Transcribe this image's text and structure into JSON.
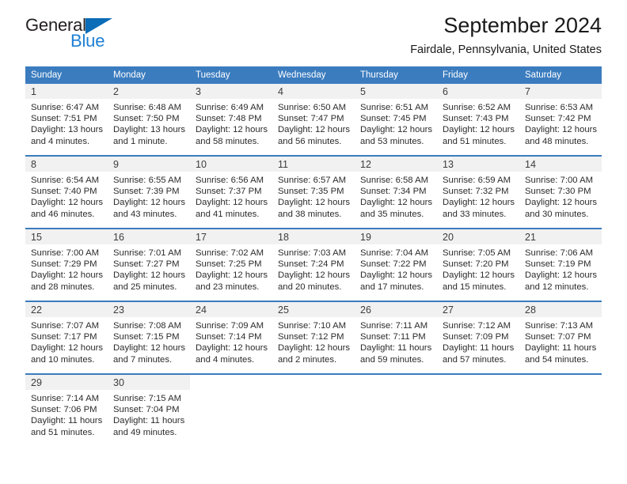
{
  "brand": {
    "name_part1": "General",
    "name_part2": "Blue",
    "triangle_color": "#0b6cb7",
    "blue_color": "#1e7fd4"
  },
  "header": {
    "title": "September 2024",
    "subtitle": "Fairdale, Pennsylvania, United States"
  },
  "theme": {
    "header_blue": "#3b7cbf",
    "daynum_band": "#f1f1f1"
  },
  "weekday_headers": [
    "Sunday",
    "Monday",
    "Tuesday",
    "Wednesday",
    "Thursday",
    "Friday",
    "Saturday"
  ],
  "weeks": [
    [
      {
        "day": "1",
        "sunrise": "Sunrise: 6:47 AM",
        "sunset": "Sunset: 7:51 PM",
        "daylight_line1": "Daylight: 13 hours",
        "daylight_line2": "and 4 minutes."
      },
      {
        "day": "2",
        "sunrise": "Sunrise: 6:48 AM",
        "sunset": "Sunset: 7:50 PM",
        "daylight_line1": "Daylight: 13 hours",
        "daylight_line2": "and 1 minute."
      },
      {
        "day": "3",
        "sunrise": "Sunrise: 6:49 AM",
        "sunset": "Sunset: 7:48 PM",
        "daylight_line1": "Daylight: 12 hours",
        "daylight_line2": "and 58 minutes."
      },
      {
        "day": "4",
        "sunrise": "Sunrise: 6:50 AM",
        "sunset": "Sunset: 7:47 PM",
        "daylight_line1": "Daylight: 12 hours",
        "daylight_line2": "and 56 minutes."
      },
      {
        "day": "5",
        "sunrise": "Sunrise: 6:51 AM",
        "sunset": "Sunset: 7:45 PM",
        "daylight_line1": "Daylight: 12 hours",
        "daylight_line2": "and 53 minutes."
      },
      {
        "day": "6",
        "sunrise": "Sunrise: 6:52 AM",
        "sunset": "Sunset: 7:43 PM",
        "daylight_line1": "Daylight: 12 hours",
        "daylight_line2": "and 51 minutes."
      },
      {
        "day": "7",
        "sunrise": "Sunrise: 6:53 AM",
        "sunset": "Sunset: 7:42 PM",
        "daylight_line1": "Daylight: 12 hours",
        "daylight_line2": "and 48 minutes."
      }
    ],
    [
      {
        "day": "8",
        "sunrise": "Sunrise: 6:54 AM",
        "sunset": "Sunset: 7:40 PM",
        "daylight_line1": "Daylight: 12 hours",
        "daylight_line2": "and 46 minutes."
      },
      {
        "day": "9",
        "sunrise": "Sunrise: 6:55 AM",
        "sunset": "Sunset: 7:39 PM",
        "daylight_line1": "Daylight: 12 hours",
        "daylight_line2": "and 43 minutes."
      },
      {
        "day": "10",
        "sunrise": "Sunrise: 6:56 AM",
        "sunset": "Sunset: 7:37 PM",
        "daylight_line1": "Daylight: 12 hours",
        "daylight_line2": "and 41 minutes."
      },
      {
        "day": "11",
        "sunrise": "Sunrise: 6:57 AM",
        "sunset": "Sunset: 7:35 PM",
        "daylight_line1": "Daylight: 12 hours",
        "daylight_line2": "and 38 minutes."
      },
      {
        "day": "12",
        "sunrise": "Sunrise: 6:58 AM",
        "sunset": "Sunset: 7:34 PM",
        "daylight_line1": "Daylight: 12 hours",
        "daylight_line2": "and 35 minutes."
      },
      {
        "day": "13",
        "sunrise": "Sunrise: 6:59 AM",
        "sunset": "Sunset: 7:32 PM",
        "daylight_line1": "Daylight: 12 hours",
        "daylight_line2": "and 33 minutes."
      },
      {
        "day": "14",
        "sunrise": "Sunrise: 7:00 AM",
        "sunset": "Sunset: 7:30 PM",
        "daylight_line1": "Daylight: 12 hours",
        "daylight_line2": "and 30 minutes."
      }
    ],
    [
      {
        "day": "15",
        "sunrise": "Sunrise: 7:00 AM",
        "sunset": "Sunset: 7:29 PM",
        "daylight_line1": "Daylight: 12 hours",
        "daylight_line2": "and 28 minutes."
      },
      {
        "day": "16",
        "sunrise": "Sunrise: 7:01 AM",
        "sunset": "Sunset: 7:27 PM",
        "daylight_line1": "Daylight: 12 hours",
        "daylight_line2": "and 25 minutes."
      },
      {
        "day": "17",
        "sunrise": "Sunrise: 7:02 AM",
        "sunset": "Sunset: 7:25 PM",
        "daylight_line1": "Daylight: 12 hours",
        "daylight_line2": "and 23 minutes."
      },
      {
        "day": "18",
        "sunrise": "Sunrise: 7:03 AM",
        "sunset": "Sunset: 7:24 PM",
        "daylight_line1": "Daylight: 12 hours",
        "daylight_line2": "and 20 minutes."
      },
      {
        "day": "19",
        "sunrise": "Sunrise: 7:04 AM",
        "sunset": "Sunset: 7:22 PM",
        "daylight_line1": "Daylight: 12 hours",
        "daylight_line2": "and 17 minutes."
      },
      {
        "day": "20",
        "sunrise": "Sunrise: 7:05 AM",
        "sunset": "Sunset: 7:20 PM",
        "daylight_line1": "Daylight: 12 hours",
        "daylight_line2": "and 15 minutes."
      },
      {
        "day": "21",
        "sunrise": "Sunrise: 7:06 AM",
        "sunset": "Sunset: 7:19 PM",
        "daylight_line1": "Daylight: 12 hours",
        "daylight_line2": "and 12 minutes."
      }
    ],
    [
      {
        "day": "22",
        "sunrise": "Sunrise: 7:07 AM",
        "sunset": "Sunset: 7:17 PM",
        "daylight_line1": "Daylight: 12 hours",
        "daylight_line2": "and 10 minutes."
      },
      {
        "day": "23",
        "sunrise": "Sunrise: 7:08 AM",
        "sunset": "Sunset: 7:15 PM",
        "daylight_line1": "Daylight: 12 hours",
        "daylight_line2": "and 7 minutes."
      },
      {
        "day": "24",
        "sunrise": "Sunrise: 7:09 AM",
        "sunset": "Sunset: 7:14 PM",
        "daylight_line1": "Daylight: 12 hours",
        "daylight_line2": "and 4 minutes."
      },
      {
        "day": "25",
        "sunrise": "Sunrise: 7:10 AM",
        "sunset": "Sunset: 7:12 PM",
        "daylight_line1": "Daylight: 12 hours",
        "daylight_line2": "and 2 minutes."
      },
      {
        "day": "26",
        "sunrise": "Sunrise: 7:11 AM",
        "sunset": "Sunset: 7:11 PM",
        "daylight_line1": "Daylight: 11 hours",
        "daylight_line2": "and 59 minutes."
      },
      {
        "day": "27",
        "sunrise": "Sunrise: 7:12 AM",
        "sunset": "Sunset: 7:09 PM",
        "daylight_line1": "Daylight: 11 hours",
        "daylight_line2": "and 57 minutes."
      },
      {
        "day": "28",
        "sunrise": "Sunrise: 7:13 AM",
        "sunset": "Sunset: 7:07 PM",
        "daylight_line1": "Daylight: 11 hours",
        "daylight_line2": "and 54 minutes."
      }
    ],
    [
      {
        "day": "29",
        "sunrise": "Sunrise: 7:14 AM",
        "sunset": "Sunset: 7:06 PM",
        "daylight_line1": "Daylight: 11 hours",
        "daylight_line2": "and 51 minutes."
      },
      {
        "day": "30",
        "sunrise": "Sunrise: 7:15 AM",
        "sunset": "Sunset: 7:04 PM",
        "daylight_line1": "Daylight: 11 hours",
        "daylight_line2": "and 49 minutes."
      },
      {
        "day": "",
        "sunrise": "",
        "sunset": "",
        "daylight_line1": "",
        "daylight_line2": ""
      },
      {
        "day": "",
        "sunrise": "",
        "sunset": "",
        "daylight_line1": "",
        "daylight_line2": ""
      },
      {
        "day": "",
        "sunrise": "",
        "sunset": "",
        "daylight_line1": "",
        "daylight_line2": ""
      },
      {
        "day": "",
        "sunrise": "",
        "sunset": "",
        "daylight_line1": "",
        "daylight_line2": ""
      },
      {
        "day": "",
        "sunrise": "",
        "sunset": "",
        "daylight_line1": "",
        "daylight_line2": ""
      }
    ]
  ]
}
